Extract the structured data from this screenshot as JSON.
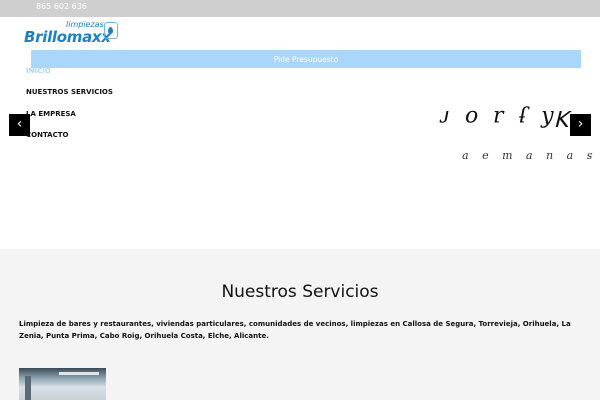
{
  "topbar": {
    "phone": "865 602 636"
  },
  "logo": {
    "name": "Brillomaxx",
    "tagline": "limpiezas"
  },
  "header": {
    "cta_label": "Pide Presupuesto"
  },
  "nav": {
    "items": [
      {
        "label": "INICIO",
        "active": true
      },
      {
        "label": "NUESTROS SERVICIOS",
        "active": false
      },
      {
        "label": "LA EMPRESA",
        "active": false
      },
      {
        "label": "CONTACTO",
        "active": false
      }
    ]
  },
  "slider": {
    "prev_icon": "chevron-left-icon",
    "next_icon": "chevron-right-icon",
    "prev_glyph": "‹",
    "next_glyph": "›"
  },
  "services": {
    "title": "Nuestros Servicios",
    "description": "Limpieza de bares y restaurantes, viviendas particulares, comunidades de vecinos, limpiezas en Callosa de Segura, Torrevieja, Orihuela, La Zenia, Punta Prima, Cabo Roig, Orihuela Costa, Elche, Alicante."
  },
  "colors": {
    "accent": "#a9d6fb",
    "brand": "#1f7fc4",
    "topbar": "#cfcfcf",
    "section_bg": "#f4f4f4"
  }
}
